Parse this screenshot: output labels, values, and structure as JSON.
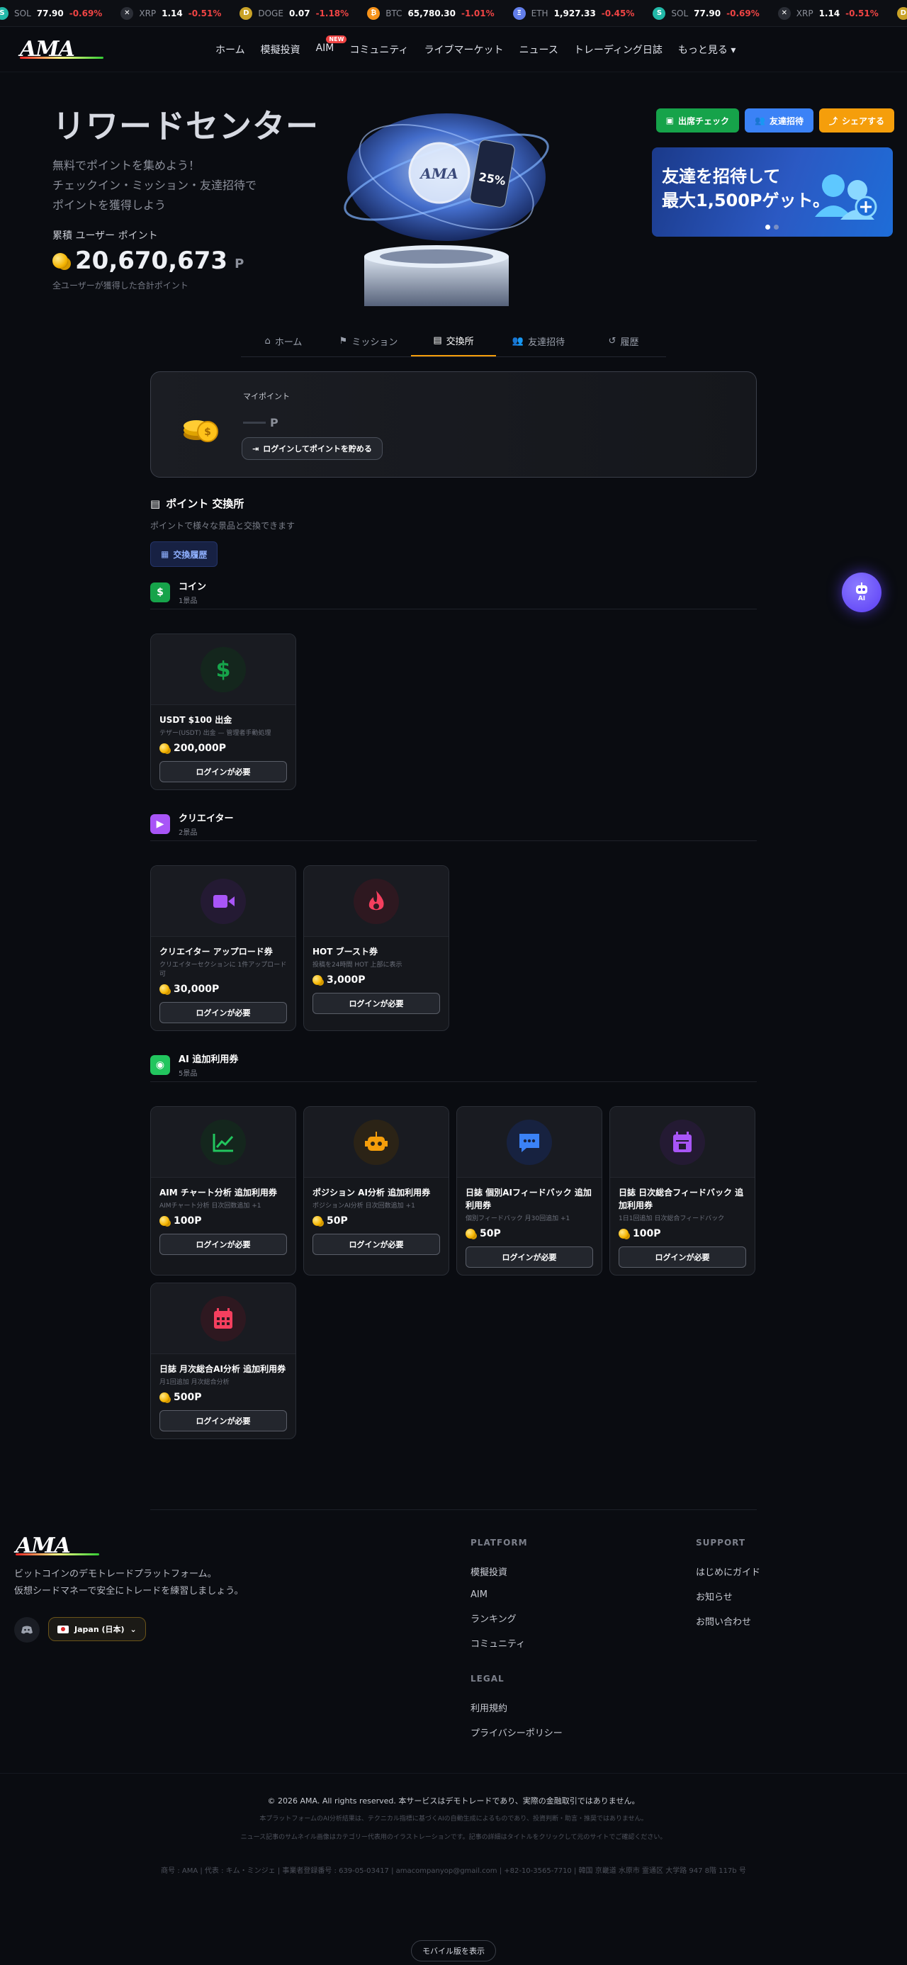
{
  "ticker": [
    {
      "sym": "SOL",
      "price": "77.90",
      "change": "-0.69%",
      "color": "#22b8a8",
      "glyph": "S"
    },
    {
      "sym": "XRP",
      "price": "1.14",
      "change": "-0.51%",
      "color": "#2b2e36",
      "glyph": "✕"
    },
    {
      "sym": "DOGE",
      "price": "0.07",
      "change": "-1.18%",
      "color": "#c9a227",
      "glyph": "D"
    },
    {
      "sym": "BTC",
      "price": "65,780.30",
      "change": "-1.01%",
      "color": "#f7931a",
      "glyph": "₿"
    },
    {
      "sym": "ETH",
      "price": "1,927.33",
      "change": "-0.45%",
      "color": "#627eea",
      "glyph": "Ξ"
    },
    {
      "sym": "SOL",
      "price": "77.90",
      "change": "-0.69%",
      "color": "#22b8a8",
      "glyph": "S"
    },
    {
      "sym": "XRP",
      "price": "1.14",
      "change": "-0.51%",
      "color": "#2b2e36",
      "glyph": "✕"
    },
    {
      "sym": "D",
      "price": "",
      "change": "",
      "color": "#c9a227",
      "glyph": "D"
    }
  ],
  "nav": {
    "logo": "AMA",
    "items": [
      "ホーム",
      "模擬投資",
      "AIM",
      "コミュニティ",
      "ライブマーケット",
      "ニュース",
      "トレーディング日誌",
      "もっと見る ▾"
    ],
    "new_badge": "NEW"
  },
  "hero": {
    "title": "リワードセンター",
    "subtitle_lines": [
      "無料でポイントを集めよう！",
      "チェックイン・ミッション・友達招待で",
      "ポイントを獲得しよう"
    ],
    "cumulative_label": "累積 ユーザー ポイント",
    "cumulative_value": "20,670,673",
    "cumulative_unit": "P",
    "note": "全ユーザーが獲得した合計ポイント",
    "orb_label": "AMA",
    "orb_badge": "25%"
  },
  "actions": [
    {
      "label": "出席チェック",
      "color": "#16a34a"
    },
    {
      "label": "友達招待",
      "color": "#3b82f6"
    },
    {
      "label": "シェアする",
      "color": "#f59e0b"
    }
  ],
  "banner": {
    "line1": "友達を招待して",
    "line2": "最大1,500Pゲット。"
  },
  "tabs": [
    {
      "label": "ホーム",
      "icon": "home-icon"
    },
    {
      "label": "ミッション",
      "icon": "flag-icon"
    },
    {
      "label": "交換所",
      "icon": "shop-icon",
      "active": true
    },
    {
      "label": "友達招待",
      "icon": "users-icon"
    },
    {
      "label": "履歴",
      "icon": "history-icon"
    }
  ],
  "my_points": {
    "label": "マイポイント",
    "unit": "P",
    "login_btn": "ログインしてポイントを貯める"
  },
  "exchange": {
    "title": "ポイント 交換所",
    "desc": "ポイントで様々な景品と交換できます",
    "history_btn": "交換履歴"
  },
  "categories": [
    {
      "name": "コイン",
      "count": "1景品",
      "color": "#16a34a",
      "glyph": "$",
      "items": [
        {
          "name": "USDT $100 出金",
          "desc": "テザー(USDT) 出金 — 管理者手動処理",
          "points": "200,000P",
          "btn": "ログインが必要",
          "icon": "dollar-icon",
          "icolor": "#16a34a",
          "bg": "#14261d"
        }
      ]
    },
    {
      "name": "クリエイター",
      "count": "2景品",
      "color": "#a855f7",
      "glyph": "▶",
      "items": [
        {
          "name": "クリエイター アップロード券",
          "desc": "クリエイターセクションに 1件アップロード可",
          "points": "30,000P",
          "btn": "ログインが必要",
          "icon": "video-icon",
          "icolor": "#a855f7",
          "bg": "#241a33"
        },
        {
          "name": "HOT ブースト券",
          "desc": "投稿を24時間 HOT 上部に表示",
          "points": "3,000P",
          "btn": "ログインが必要",
          "icon": "flame-icon",
          "icolor": "#f43f5e",
          "bg": "#2e1820"
        }
      ]
    },
    {
      "name": "AI 追加利用券",
      "count": "5景品",
      "color": "#22c55e",
      "glyph": "◉",
      "items": [
        {
          "name": "AIM チャート分析 追加利用券",
          "desc": "AIMチャート分析 日次回数追加 +1",
          "points": "100P",
          "btn": "ログインが必要",
          "icon": "chart-icon",
          "icolor": "#22c55e",
          "bg": "#14261d"
        },
        {
          "name": "ポジション AI分析 追加利用券",
          "desc": "ポジションAI分析 日次回数追加 +1",
          "points": "50P",
          "btn": "ログインが必要",
          "icon": "robot-icon",
          "icolor": "#f59e0b",
          "bg": "#2b2316"
        },
        {
          "name": "日誌 個別AIフィードバック 追加利用券",
          "desc": "個別フィードバック 月30回追加 +1",
          "points": "50P",
          "btn": "ログインが必要",
          "icon": "chat-icon",
          "icolor": "#3b82f6",
          "bg": "#172240"
        },
        {
          "name": "日誌 日次総合フィードバック 追加利用券",
          "desc": "1日1回追加 日次総合フィードバック",
          "points": "100P",
          "btn": "ログインが必要",
          "icon": "calendar-icon",
          "icolor": "#a855f7",
          "bg": "#241a33"
        },
        {
          "name": "日誌 月次総合AI分析 追加利用券",
          "desc": "月1回追加 月次総合分析",
          "points": "500P",
          "btn": "ログインが必要",
          "icon": "calendar-grid-icon",
          "icolor": "#f43f5e",
          "bg": "#2e1820"
        }
      ]
    }
  ],
  "ai_fab": "AI",
  "footer": {
    "desc_lines": [
      "ビットコインのデモトレードプラットフォーム。",
      "仮想シードマネーで安全にトレードを練習しましょう。"
    ],
    "lang": "Japan (日本)",
    "platform_title": "PLATFORM",
    "platform": [
      "模擬投資",
      "AIM",
      "ランキング",
      "コミュニティ"
    ],
    "legal_title": "LEGAL",
    "legal": [
      "利用規約",
      "プライバシーポリシー"
    ],
    "support_title": "SUPPORT",
    "support": [
      "はじめにガイド",
      "お知らせ",
      "お問い合わせ"
    ],
    "copyright": "© 2026 AMA. All rights reserved. 本サービスはデモトレードであり、実際の金融取引ではありません。",
    "disclaimer1": "本プラットフォームのAI分析結果は、テクニカル指標に基づくAIの自動生成によるものであり、投資判断・助言・推奨ではありません。",
    "disclaimer2": "ニュース記事のサムネイル画像はカテゴリー代表用のイラストレーションです。記事の詳細はタイトルをクリックして元のサイトでご確認ください。",
    "info": "商号 : AMA   |   代表 : キム・ミンジェ   |   事業者登録番号 : 639-05-03417   |   amacompanyop@gmail.com   |   +82-10-3565-7710   |   韓国 京畿道 水原市 霊通区 大学路 947 8階 117b 号",
    "mobile_btn": "モバイル版を表示"
  }
}
